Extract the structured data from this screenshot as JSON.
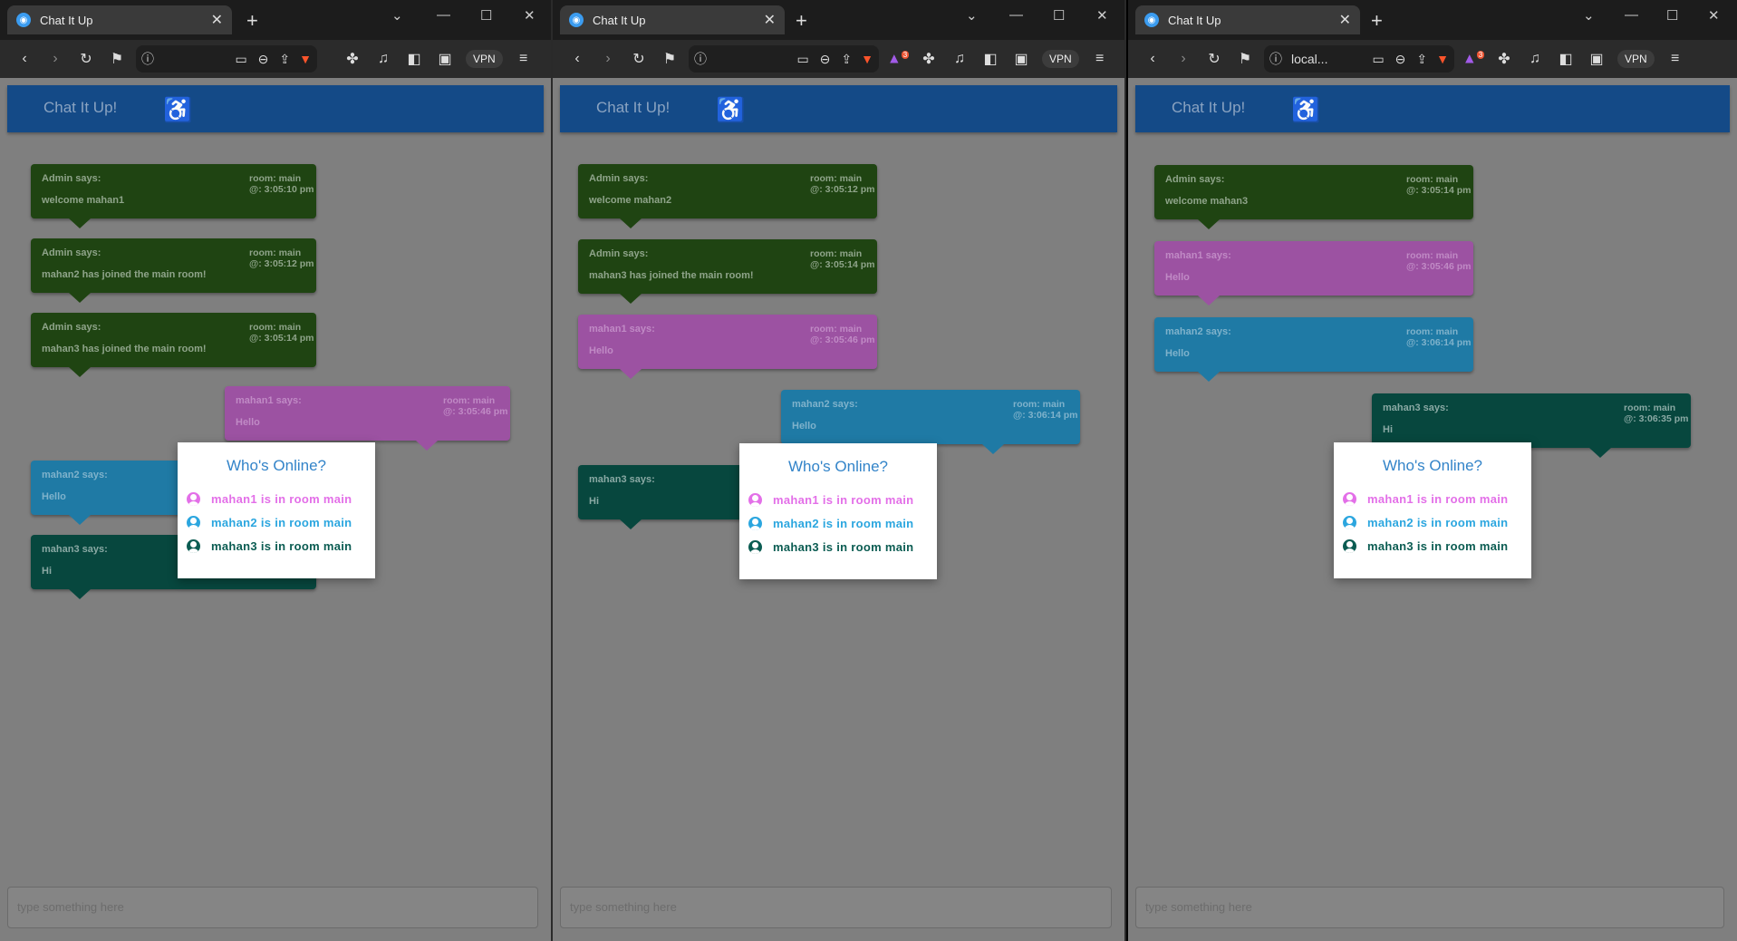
{
  "app_title": "Chat It Up!",
  "windows": [
    {
      "tab_title": "Chat It Up",
      "address": "",
      "messages": [
        {
          "author": "Admin says:",
          "text": "welcome mahan1",
          "room": "room: main",
          "time": "@: 3:05:10 pm",
          "kind": "admin"
        },
        {
          "author": "Admin says:",
          "text": "mahan2 has joined the main room!",
          "room": "room: main",
          "time": "@: 3:05:12 pm",
          "kind": "admin"
        },
        {
          "author": "Admin says:",
          "text": "mahan3 has joined the main room!",
          "room": "room: main",
          "time": "@: 3:05:14 pm",
          "kind": "admin"
        },
        {
          "author": "mahan1 says:",
          "text": "Hello",
          "room": "room: main",
          "time": "@: 3:05:46 pm",
          "kind": "m1"
        },
        {
          "author": "mahan2 says:",
          "text": "Hello",
          "room": "",
          "time": "",
          "kind": "m2"
        },
        {
          "author": "mahan3 says:",
          "text": "Hi",
          "room": "",
          "time": "",
          "kind": "m3"
        }
      ]
    },
    {
      "tab_title": "Chat It Up",
      "address": "",
      "messages": [
        {
          "author": "Admin says:",
          "text": "welcome mahan2",
          "room": "room: main",
          "time": "@: 3:05:12 pm",
          "kind": "admin"
        },
        {
          "author": "Admin says:",
          "text": "mahan3 has joined the main room!",
          "room": "room: main",
          "time": "@: 3:05:14 pm",
          "kind": "admin"
        },
        {
          "author": "mahan1 says:",
          "text": "Hello",
          "room": "room: main",
          "time": "@: 3:05:46 pm",
          "kind": "m1"
        },
        {
          "author": "mahan2 says:",
          "text": "Hello",
          "room": "room: main",
          "time": "@: 3:06:14 pm",
          "kind": "m2"
        },
        {
          "author": "mahan3 says:",
          "text": "Hi",
          "room": "",
          "time": "",
          "kind": "m3"
        }
      ]
    },
    {
      "tab_title": "Chat It Up",
      "address": "local...",
      "messages": [
        {
          "author": "Admin says:",
          "text": "welcome mahan3",
          "room": "room: main",
          "time": "@: 3:05:14 pm",
          "kind": "admin"
        },
        {
          "author": "mahan1 says:",
          "text": "Hello",
          "room": "room: main",
          "time": "@: 3:05:46 pm",
          "kind": "m1"
        },
        {
          "author": "mahan2 says:",
          "text": "Hello",
          "room": "room: main",
          "time": "@: 3:06:14 pm",
          "kind": "m2"
        },
        {
          "author": "mahan3 says:",
          "text": "Hi",
          "room": "room: main",
          "time": "@: 3:06:35 pm",
          "kind": "m3"
        }
      ]
    }
  ],
  "online": {
    "title": "Who's Online?",
    "users": [
      {
        "text": "mahan1 is in room main",
        "color": "#e36fe8"
      },
      {
        "text": "mahan2 is in room main",
        "color": "#2ba6df"
      },
      {
        "text": "mahan3 is in room main",
        "color": "#0b5c52"
      }
    ]
  },
  "input_placeholder": "type something here",
  "vpn_label": "VPN",
  "badge_count": "3"
}
